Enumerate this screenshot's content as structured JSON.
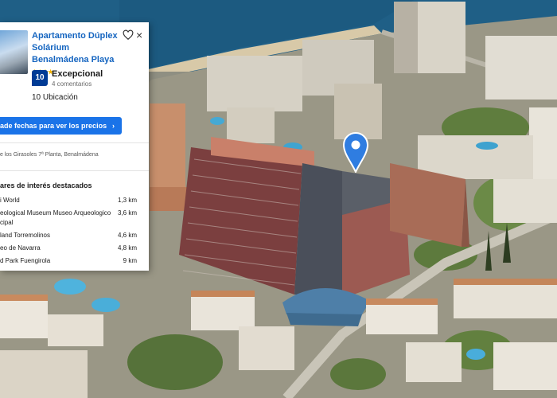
{
  "hotel": {
    "name": "Apartamento Dúplex Solárium Benalmádena Playa",
    "stars": "★★★★",
    "score": "10",
    "score_word": "Excepcional",
    "reviews": "4 comentarios",
    "location_score": "10 Ubicación",
    "cta_label": "ade fechas para ver los precios",
    "cta_arrow": "›",
    "address": "e los Girasoles 7ª Planta, Benalmádena",
    "close_symbol": "×"
  },
  "poi": {
    "title": "ares de interés destacados",
    "items": [
      {
        "name": "i World",
        "distance": "1,3 km"
      },
      {
        "name": "eological Museum Museo Arqueologico cipal",
        "distance": "3,6 km"
      },
      {
        "name": "land Torremolinos",
        "distance": "4,6 km"
      },
      {
        "name": "eo de Navarra",
        "distance": "4,8 km"
      },
      {
        "name": "d Park Fuengirola",
        "distance": "9 km"
      }
    ]
  },
  "colors": {
    "link": "#1565c0",
    "badge": "#003b95",
    "button": "#1a73e8",
    "pin": "#2f7de1"
  },
  "icons": [
    "heart-icon",
    "close-icon",
    "map-pin-icon",
    "chevron-right-icon"
  ]
}
